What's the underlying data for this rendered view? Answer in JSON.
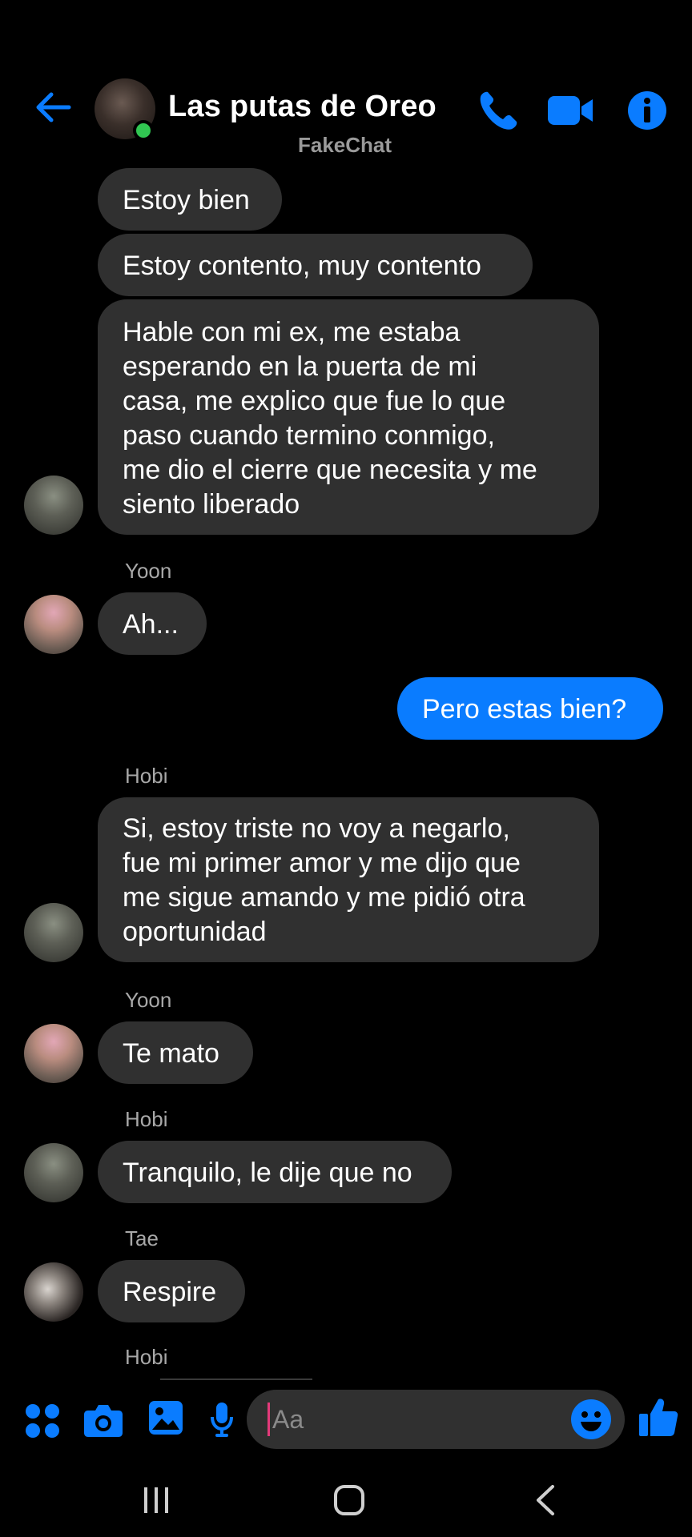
{
  "header": {
    "title": "Las putas de Oreo",
    "subtitle": "FakeChat",
    "icons": [
      "back-arrow-icon",
      "phone-icon",
      "video-camera-icon",
      "info-icon"
    ],
    "accent_color": "#0a7cff",
    "online_color": "#31c652"
  },
  "messages": [
    {
      "sender": "",
      "text": "Estoy bien",
      "mine": false
    },
    {
      "sender": "",
      "text": "Estoy contento, muy contento",
      "mine": false
    },
    {
      "sender": "",
      "text": "Hable con mi ex, me estaba\nesperando en la puerta de mi\ncasa, me explico que fue lo que\npaso cuando termino conmigo,\nme dio el cierre que necesita y me\nsiento liberado",
      "mine": false
    },
    {
      "sender": "Yoon",
      "text": "Ah...",
      "mine": false
    },
    {
      "sender": "",
      "text": "Pero estas bien?",
      "mine": true
    },
    {
      "sender": "Hobi",
      "text": "Si, estoy triste no voy a negarlo,\nfue mi primer amor y me dijo que\nme sigue amando y me pidió otra\noportunidad",
      "mine": false
    },
    {
      "sender": "Yoon",
      "text": "Te mato",
      "mine": false
    },
    {
      "sender": "Hobi",
      "text": "Tranquilo, le dije que no",
      "mine": false
    },
    {
      "sender": "Tae",
      "text": "Respire",
      "mine": false
    },
    {
      "sender": "Hobi",
      "text": "",
      "mine": false
    }
  ],
  "composer": {
    "placeholder": "Aa",
    "icons": [
      "apps-icon",
      "camera-icon",
      "gallery-icon",
      "microphone-icon",
      "emoji-icon",
      "thumbs-up-icon"
    ]
  },
  "system_nav": {
    "icons": [
      "recents-icon",
      "home-icon",
      "back-icon"
    ]
  },
  "colors": {
    "background": "#000000",
    "bubble_other": "#303030",
    "bubble_mine": "#0a7cff",
    "sender_label": "#a8a8a8"
  }
}
